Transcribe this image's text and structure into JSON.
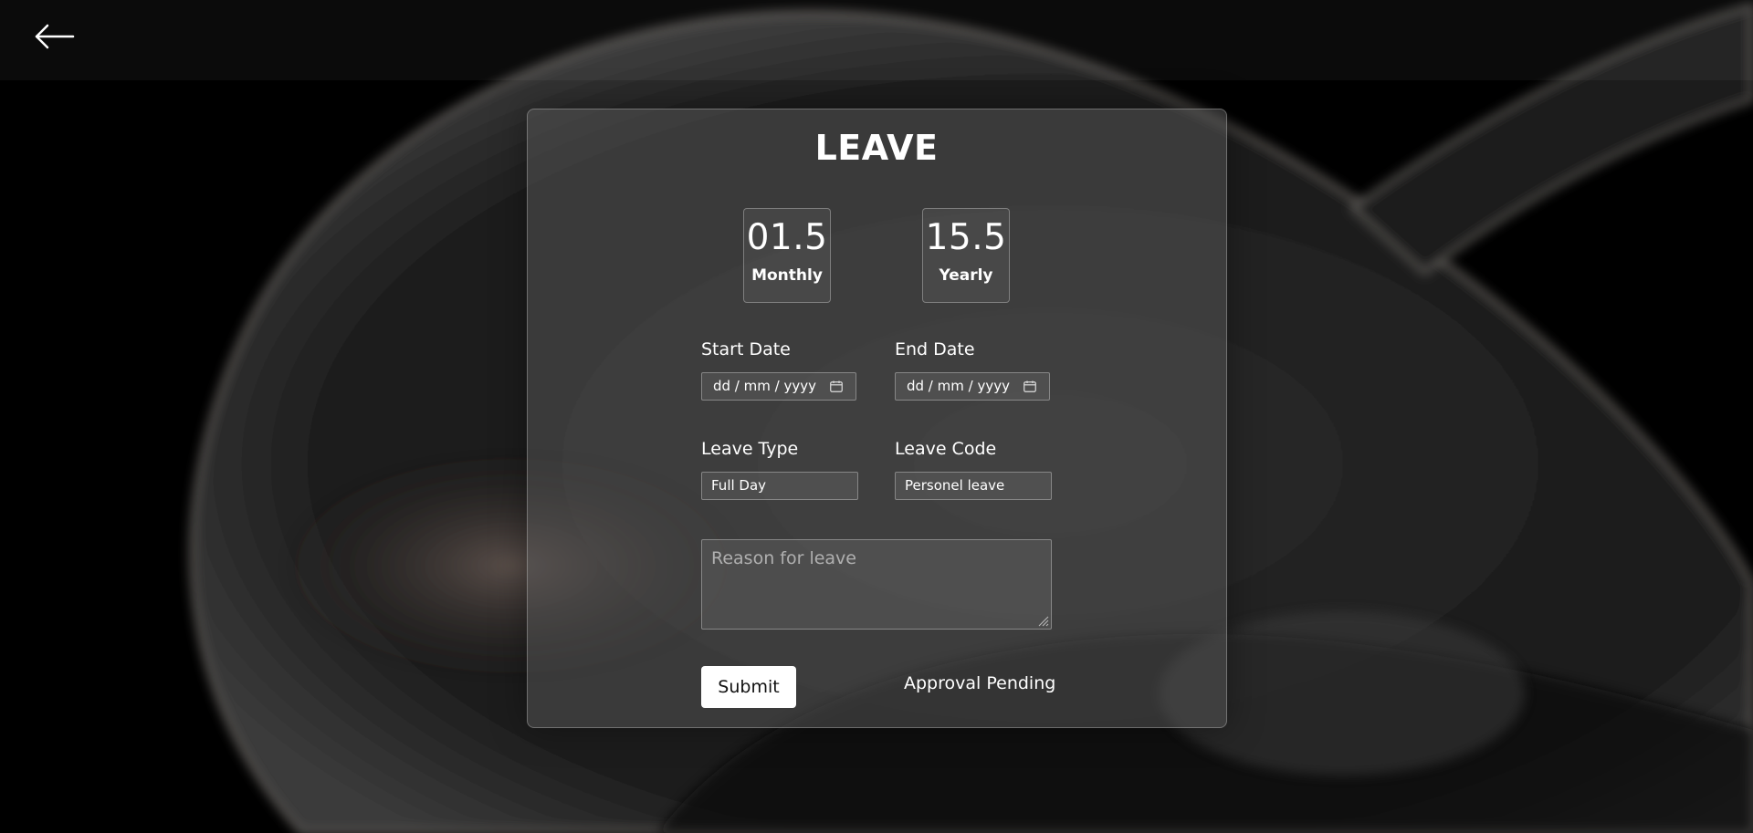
{
  "header": {
    "back_icon": "arrow-left-icon"
  },
  "form": {
    "title": "LEAVE",
    "stats": [
      {
        "value": "01.5",
        "label": "Monthly"
      },
      {
        "value": "15.5",
        "label": "Yearly"
      }
    ],
    "start_date": {
      "label": "Start Date",
      "placeholder": "dd / mm / yyyy",
      "icon": "calendar-icon"
    },
    "end_date": {
      "label": "End Date",
      "placeholder": "dd / mm / yyyy",
      "icon": "calendar-icon"
    },
    "leave_type": {
      "label": "Leave Type",
      "value": "Full Day"
    },
    "leave_code": {
      "label": "Leave Code",
      "value": "Personel leave"
    },
    "reason": {
      "placeholder": "Reason for leave"
    },
    "submit_label": "Submit",
    "status_text": "Approval Pending"
  },
  "colors": {
    "background": "#000000",
    "card": "#4a4a4a",
    "text": "#ffffff",
    "button": "#ffffff"
  }
}
